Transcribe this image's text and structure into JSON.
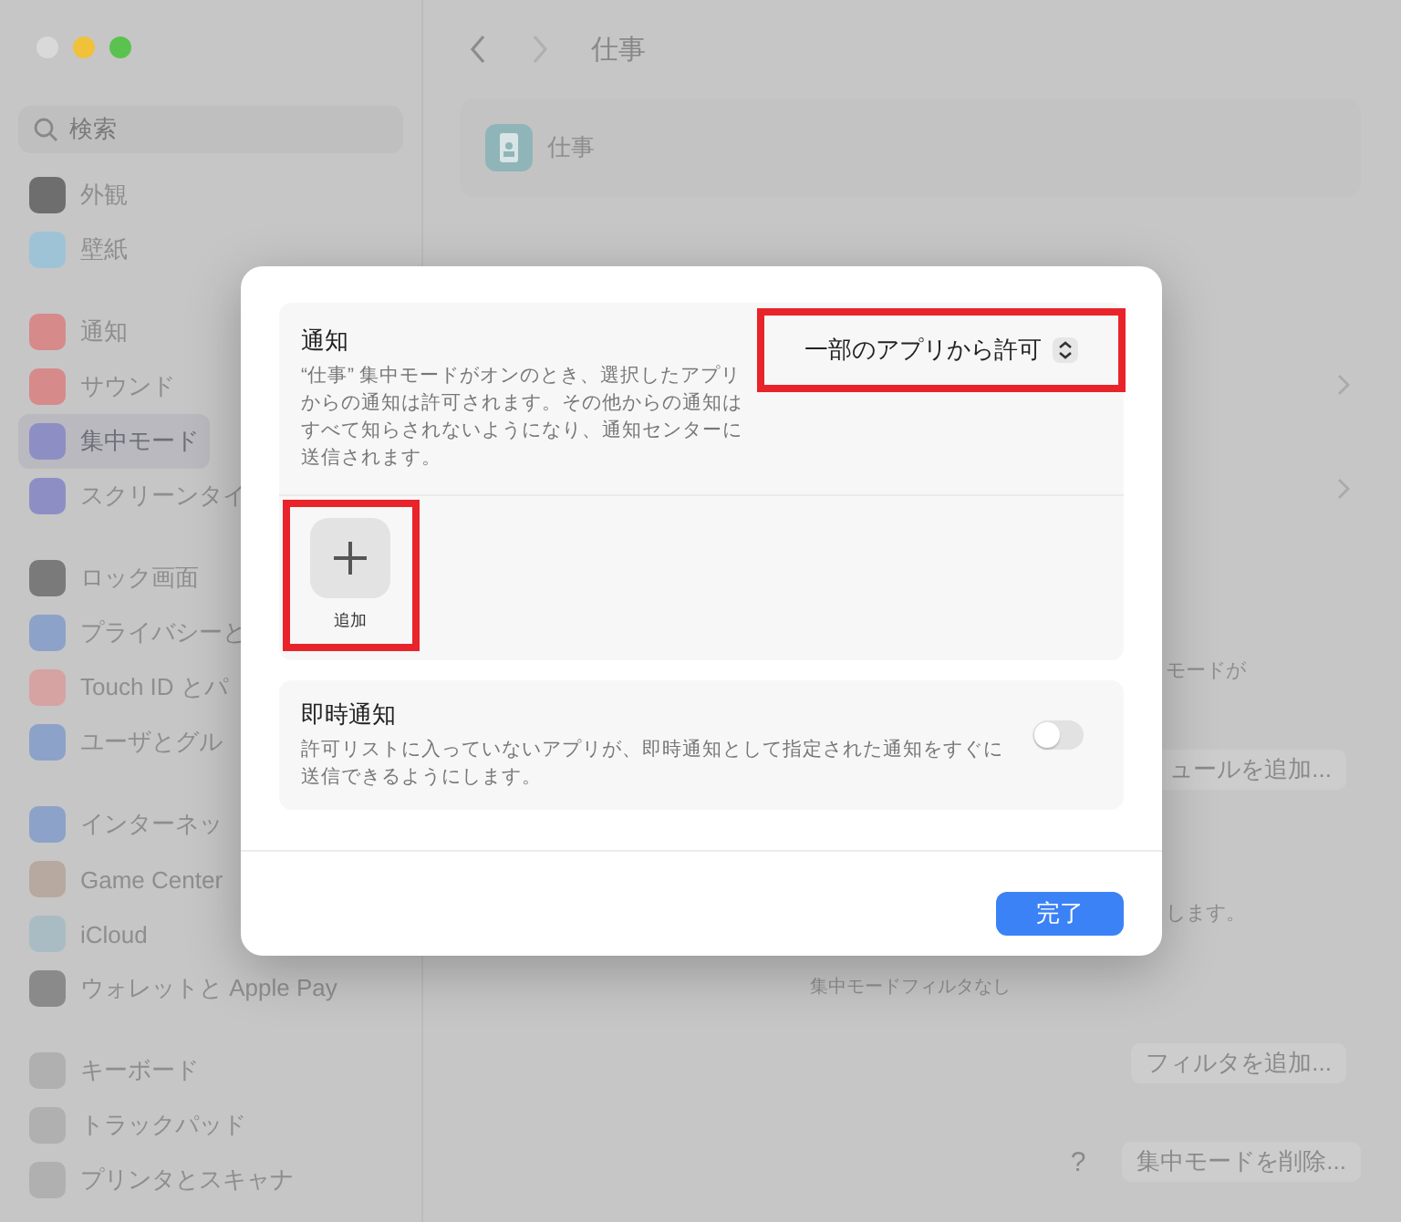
{
  "sidebar": {
    "search": {
      "placeholder": "検索"
    },
    "groups": [
      [
        {
          "label": "外観",
          "selected": false,
          "color": "#6e6e6e"
        },
        {
          "label": "壁紙",
          "selected": false,
          "color": "#9fc3d6"
        }
      ],
      [
        {
          "label": "通知",
          "selected": false,
          "color": "#d68a8a"
        },
        {
          "label": "サウンド",
          "selected": false,
          "color": "#d68a8a"
        },
        {
          "label": "集中モード",
          "selected": true,
          "color": "#8d8fc4"
        },
        {
          "label": "スクリーンタイ",
          "selected": false,
          "color": "#8d8fc4"
        }
      ],
      [
        {
          "label": "ロック画面",
          "selected": false,
          "color": "#7a7a7a"
        },
        {
          "label": "プライバシーと",
          "selected": false,
          "color": "#8da2c8"
        },
        {
          "label": "Touch ID とパ",
          "selected": false,
          "color": "#d6a2a2"
        },
        {
          "label": "ユーザとグル",
          "selected": false,
          "color": "#8da2c8"
        }
      ],
      [
        {
          "label": "インターネッ",
          "selected": false,
          "color": "#8da2c8"
        },
        {
          "label": "Game Center",
          "selected": false,
          "color": "#b7a9a0"
        },
        {
          "label": "iCloud",
          "selected": false,
          "color": "#a9bcc4"
        },
        {
          "label": "ウォレットと Apple Pay",
          "selected": false,
          "color": "#8a8a8a"
        }
      ],
      [
        {
          "label": "キーボード",
          "selected": false,
          "color": "#b0b0b0"
        },
        {
          "label": "トラックパッド",
          "selected": false,
          "color": "#b0b0b0"
        },
        {
          "label": "プリンタとスキャナ",
          "selected": false,
          "color": "#b0b0b0"
        }
      ]
    ]
  },
  "main": {
    "title": "仕事",
    "focus_card": {
      "name": "仕事"
    },
    "mode_note": "モードが",
    "schedule_button": "ュールを追加...",
    "note_tail": "します。",
    "filter_status": "集中モードフィルタなし",
    "add_filter_button": "フィルタを追加...",
    "help_button": "?",
    "delete_button": "集中モードを削除..."
  },
  "dialog": {
    "sections": [
      {
        "kind": "app-list",
        "title": "通知",
        "description": "“仕事” 集中モードがオンのとき、選択したアプリからの通知は許可されます。その他からの通知はすべて知らされないようになり、通知センターに送信されます。",
        "popup": {
          "value": "一部のアプリから許可",
          "highlighted": true
        },
        "add_button": {
          "label": "追加",
          "highlighted": true
        }
      },
      {
        "kind": "toggle",
        "title": "即時通知",
        "description": "許可リストに入っていないアプリが、即時通知として指定された通知をすぐに送信できるようにします。",
        "on": false
      }
    ],
    "done_button": "完了"
  }
}
